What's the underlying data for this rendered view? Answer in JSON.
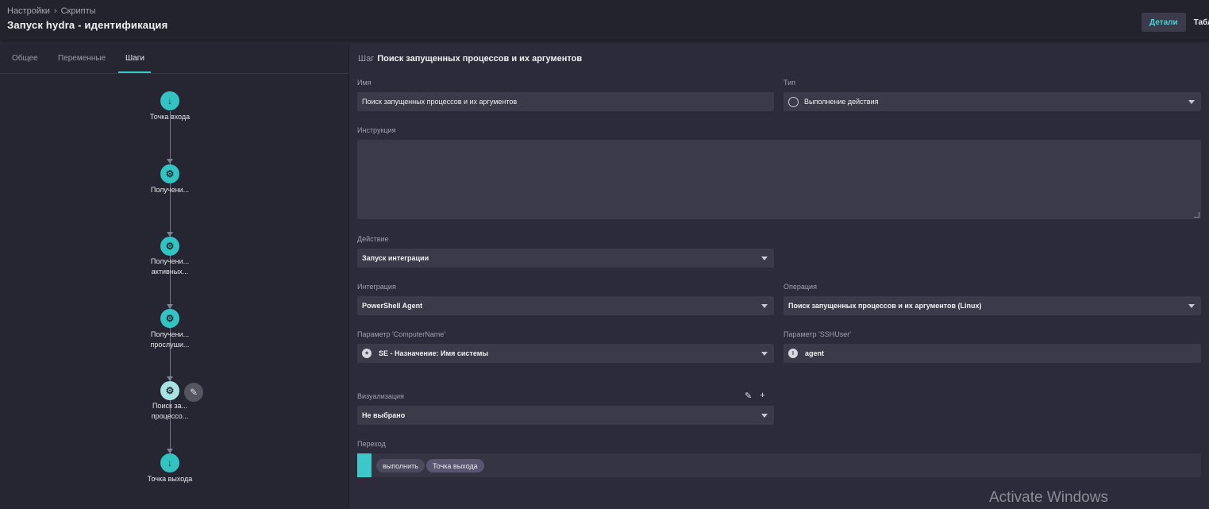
{
  "header": {
    "breadcrumb": [
      "Настройки",
      "Скрипты"
    ],
    "title": "Запуск hydra - идентификация",
    "view_toggle": [
      "Детали",
      "Табл"
    ]
  },
  "left_tabs": [
    "Общее",
    "Переменные",
    "Шаги"
  ],
  "active_tab": "Шаги",
  "flow": {
    "nodes": [
      {
        "label_lines": [
          "Точка входа"
        ],
        "icon": "arrow-down-icon"
      },
      {
        "label_lines": [
          "Получени..."
        ],
        "icon": "gear-icon"
      },
      {
        "label_lines": [
          "Получени...",
          "активных..."
        ],
        "icon": "gear-icon"
      },
      {
        "label_lines": [
          "Получени...",
          "прослуши..."
        ],
        "icon": "gear-icon"
      },
      {
        "label_lines": [
          "Поиск за...",
          "процессо..."
        ],
        "icon": "gear-icon",
        "selected": true
      },
      {
        "label_lines": [
          "Точка выхода"
        ],
        "icon": "arrow-down-icon"
      }
    ]
  },
  "step": {
    "prefix": "Шаг",
    "name": "Поиск запущенных процессов и их аргументов",
    "name_label": "Имя",
    "name_value": "Поиск запущенных процессов и их аргументов",
    "type_label": "Тип",
    "type_value": "Выполнение действия",
    "instruction_label": "Инструкция",
    "action_label": "Действие",
    "action_value": "Запуск интеграции",
    "integration_label": "Интеграция",
    "integration_value": "PowerShell Agent",
    "operation_label": "Операция",
    "operation_value": "Поиск запущенных процессов и их аргументов (Linux)",
    "param_computer_label": "Параметр 'ComputerName'",
    "param_computer_value": "SE - Назначение: Имя системы",
    "param_sshuser_label": "Параметр 'SSHUser'",
    "param_sshuser_value": "agent",
    "visualization_label": "Визуализация",
    "visualization_value": "Не выбрано",
    "transition_label": "Переход",
    "transition_chips": [
      "выполнить",
      "Точка выхода"
    ]
  },
  "watermark": "Activate Windows",
  "colors": {
    "accent": "#3ec7c7",
    "background": "#2b2b39"
  }
}
